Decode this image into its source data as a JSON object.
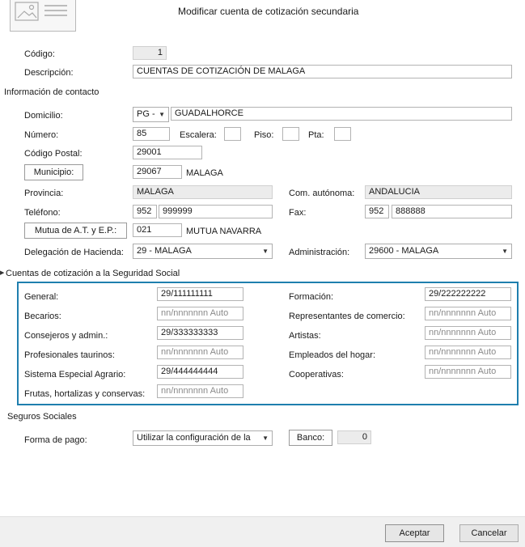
{
  "window": {
    "title": "Modificar cuenta de cotización secundaria"
  },
  "header": {
    "icon": "form-document-icon"
  },
  "fields": {
    "codigo": {
      "label": "Código:",
      "value": "1"
    },
    "descripcion": {
      "label": "Descripción:",
      "value": "CUENTAS DE COTIZACIÓN DE MALAGA"
    }
  },
  "contact": {
    "section_title": "Información de contacto",
    "domicilio": {
      "label": "Domicilio:",
      "tipo": "PG -",
      "value": "GUADALHORCE"
    },
    "numero": {
      "label": "Número:",
      "value": "85"
    },
    "escalera": {
      "label": "Escalera:",
      "value": ""
    },
    "piso": {
      "label": "Piso:",
      "value": ""
    },
    "pta": {
      "label": "Pta:",
      "value": ""
    },
    "codigo_postal": {
      "label": "Código Postal:",
      "value": "29001"
    },
    "municipio": {
      "button": "Municipio:",
      "code": "29067",
      "name": "MALAGA"
    },
    "provincia": {
      "label": "Provincia:",
      "value": "MALAGA"
    },
    "com_autonoma": {
      "label": "Com. autónoma:",
      "value": "ANDALUCIA"
    },
    "telefono": {
      "label": "Teléfono:",
      "prefix": "952",
      "number": "999999"
    },
    "fax": {
      "label": "Fax:",
      "prefix": "952",
      "number": "888888"
    },
    "mutua": {
      "button": "Mutua de A.T. y E.P.:",
      "code": "021",
      "name": "MUTUA NAVARRA"
    },
    "delegacion": {
      "label": "Delegación de Hacienda:",
      "value": "29 - MALAGA"
    },
    "administracion": {
      "label": "Administración:",
      "value": "29600 - MALAGA"
    }
  },
  "cuentas": {
    "section_title": "Cuentas de cotización a la Seguridad Social",
    "left": [
      {
        "label": "General:",
        "value": "29/111111111",
        "placeholder": false
      },
      {
        "label": "Becarios:",
        "value": "nn/nnnnnnn Auto",
        "placeholder": true
      },
      {
        "label": "Consejeros y admin.:",
        "value": "29/333333333",
        "placeholder": false
      },
      {
        "label": "Profesionales taurinos:",
        "value": "nn/nnnnnnn Auto",
        "placeholder": true
      },
      {
        "label": "Sistema Especial Agrario:",
        "value": "29/444444444",
        "placeholder": false
      },
      {
        "label": "Frutas, hortalizas y conservas:",
        "value": "nn/nnnnnnn Auto",
        "placeholder": true
      }
    ],
    "right": [
      {
        "label": "Formación:",
        "value": "29/222222222",
        "placeholder": false
      },
      {
        "label": "Representantes de comercio:",
        "value": "nn/nnnnnnn Auto",
        "placeholder": true
      },
      {
        "label": "Artistas:",
        "value": "nn/nnnnnnn Auto",
        "placeholder": true
      },
      {
        "label": "Empleados del hogar:",
        "value": "nn/nnnnnnn Auto",
        "placeholder": true
      },
      {
        "label": "Cooperativas:",
        "value": "nn/nnnnnnn Auto",
        "placeholder": true
      }
    ]
  },
  "seguros": {
    "section_title": "Seguros Sociales",
    "forma_pago": {
      "label": "Forma de pago:",
      "value": "Utilizar la configuración de la"
    },
    "banco": {
      "button": "Banco:",
      "value": "0"
    }
  },
  "footer": {
    "accept": "Aceptar",
    "cancel": "Cancelar"
  },
  "colors": {
    "section_border": "#1f7fae",
    "footer_bg": "#f0f0f0"
  }
}
